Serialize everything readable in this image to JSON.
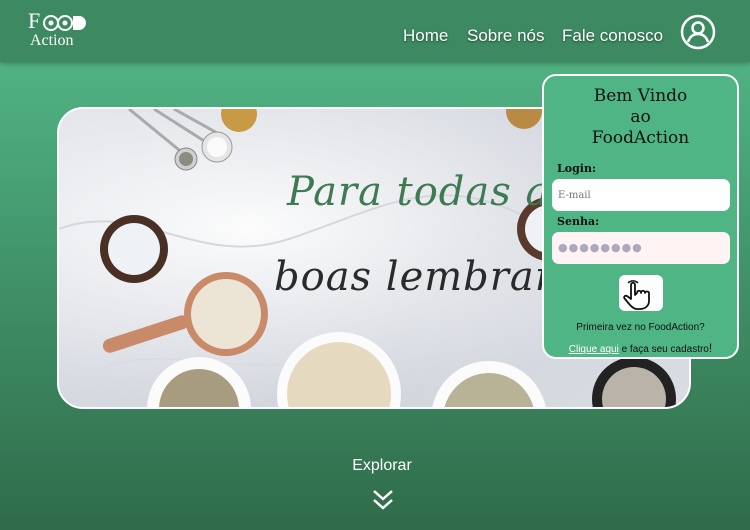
{
  "brand": {
    "line1": "F",
    "line2": "Action"
  },
  "nav": {
    "home": "Home",
    "about": "Sobre nós",
    "contact": "Fale conosco"
  },
  "hero": {
    "line1": "Para todas as",
    "line2": "boas lembranças."
  },
  "login": {
    "title_line1": "Bem Vindo",
    "title_line2": "ao",
    "title_line3": "FoodAction",
    "login_label": "Login:",
    "email_placeholder": "E-mail",
    "password_label": "Senha:",
    "password_value": "●●●●●●●●",
    "first_time": "Primeira vez no FoodAction?",
    "signup_link": "Clique aqui",
    "signup_rest": " e faça seu cadastro",
    "signup_bang": "!"
  },
  "explore": {
    "label": "Explorar"
  },
  "colors": {
    "header": "#3d8a62",
    "panel": "#4fb584",
    "accent_text": "#3e7a52"
  },
  "icons": {
    "user": "user-circle-icon",
    "enter": "hand-pointer-icon",
    "explore": "double-chevron-down-icon"
  }
}
